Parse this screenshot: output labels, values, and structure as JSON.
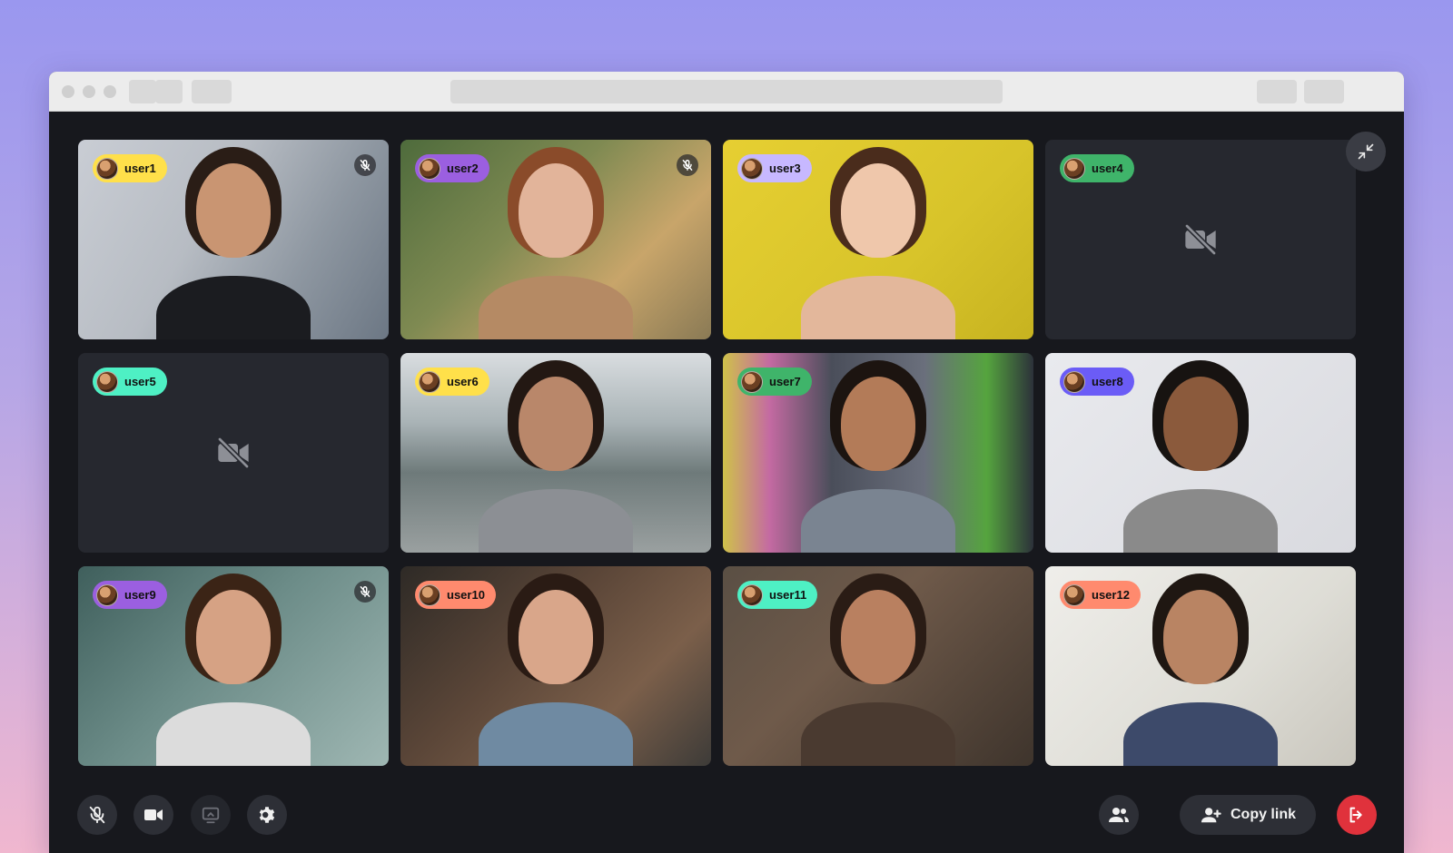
{
  "participants": [
    {
      "name": "user1",
      "badge_color": "#ffe04a",
      "muted": true,
      "camera": "on"
    },
    {
      "name": "user2",
      "badge_color": "#9b5fe0",
      "muted": true,
      "camera": "on"
    },
    {
      "name": "user3",
      "badge_color": "#c7b8ff",
      "muted": false,
      "camera": "on"
    },
    {
      "name": "user4",
      "badge_color": "#3fb46a",
      "muted": false,
      "camera": "off"
    },
    {
      "name": "user5",
      "badge_color": "#4ef0c4",
      "muted": false,
      "camera": "off"
    },
    {
      "name": "user6",
      "badge_color": "#ffe04a",
      "muted": false,
      "camera": "on"
    },
    {
      "name": "user7",
      "badge_color": "#3fb46a",
      "muted": false,
      "camera": "on"
    },
    {
      "name": "user8",
      "badge_color": "#6b5cf6",
      "muted": false,
      "camera": "on"
    },
    {
      "name": "user9",
      "badge_color": "#9b5fe0",
      "muted": true,
      "camera": "on"
    },
    {
      "name": "user10",
      "badge_color": "#ff8a6e",
      "muted": false,
      "camera": "on"
    },
    {
      "name": "user11",
      "badge_color": "#4ef0c4",
      "muted": false,
      "camera": "on"
    },
    {
      "name": "user12",
      "badge_color": "#ff8a6e",
      "muted": false,
      "camera": "on"
    }
  ],
  "toolbar": {
    "mic_icon": "mic-off-icon",
    "camera_icon": "video-camera-icon",
    "screen_share_icon": "screen-share-icon",
    "settings_icon": "gear-icon",
    "participants_icon": "people-icon",
    "copy_link_label": "Copy link",
    "copy_link_icon": "add-person-icon",
    "leave_icon": "exit-door-icon",
    "leave_color": "#e0323c"
  },
  "collapse_icon": "minimize-arrows-icon"
}
